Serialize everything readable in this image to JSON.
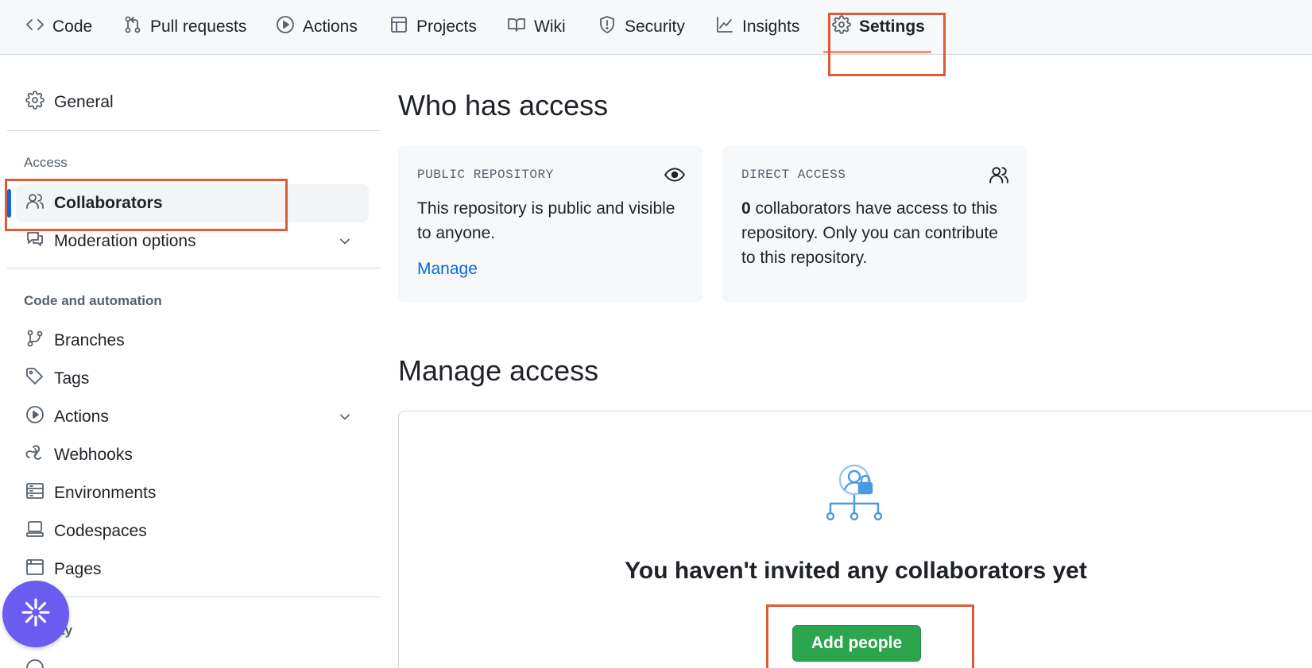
{
  "tabs": [
    {
      "label": "Code",
      "icon": "code-icon"
    },
    {
      "label": "Pull requests",
      "icon": "git-pull-request-icon"
    },
    {
      "label": "Actions",
      "icon": "play-icon"
    },
    {
      "label": "Projects",
      "icon": "table-icon"
    },
    {
      "label": "Wiki",
      "icon": "book-icon"
    },
    {
      "label": "Security",
      "icon": "shield-icon"
    },
    {
      "label": "Insights",
      "icon": "graph-icon"
    },
    {
      "label": "Settings",
      "icon": "gear-icon",
      "selected": true
    }
  ],
  "sidebar": {
    "general": "General",
    "access_label": "Access",
    "collaborators": "Collaborators",
    "moderation": "Moderation options",
    "code_automation_label": "Code and automation",
    "branches": "Branches",
    "tags": "Tags",
    "actions": "Actions",
    "webhooks": "Webhooks",
    "environments": "Environments",
    "codespaces": "Codespaces",
    "pages": "Pages",
    "security_label_partial": "ty"
  },
  "main": {
    "who_has_access": "Who has access",
    "public_card": {
      "label": "PUBLIC REPOSITORY",
      "text": "This repository is public and visible to anyone.",
      "link": "Manage"
    },
    "direct_card": {
      "label": "DIRECT ACCESS",
      "count": "0",
      "text": " collaborators have access to this repository. Only you can contribute to this repository."
    },
    "manage_access": "Manage access",
    "empty_title": "You haven't invited any collaborators yet",
    "add_people": "Add people"
  },
  "colors": {
    "accent": "#0969da",
    "primary_button": "#2da44e",
    "annotation": "#e05a35",
    "fab": "#6b5cf0"
  }
}
